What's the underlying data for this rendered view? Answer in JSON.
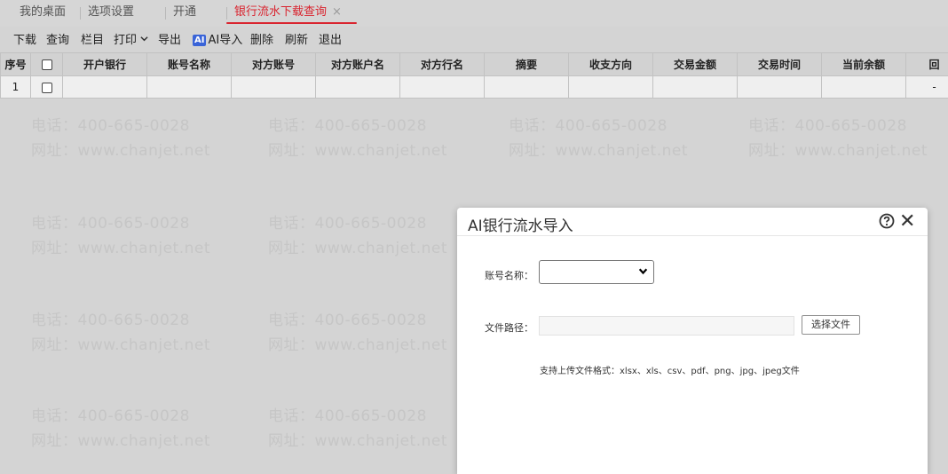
{
  "tabs": [
    {
      "label": "我的桌面",
      "active": false
    },
    {
      "label": "选项设置",
      "active": false
    },
    {
      "label": "开通",
      "active": false
    },
    {
      "label": "银行流水下载查询",
      "active": true,
      "close": "×"
    }
  ],
  "toolbar": {
    "download": "下载",
    "query": "查询",
    "columns": "栏目",
    "print": "打印",
    "print_caret": "⌄",
    "export": "导出",
    "ai_badge": "AI",
    "ai_import": "AI导入",
    "delete": "删除",
    "refresh": "刷新",
    "exit": "退出"
  },
  "table": {
    "headers": [
      "序号",
      "",
      "开户银行",
      "账号名称",
      "对方账号",
      "对方账户名",
      "对方行名",
      "摘要",
      "收支方向",
      "交易金额",
      "交易时间",
      "当前余额",
      "回"
    ],
    "rows": [
      {
        "index": "1",
        "last": "-"
      }
    ]
  },
  "watermark": {
    "phone": "电话：400-665-0028",
    "site": "网址：www.chanjet.net"
  },
  "dialog": {
    "title": "AI银行流水导入",
    "account_label": "账号名称：",
    "account_value": "",
    "file_label": "文件路径：",
    "file_value": "",
    "choose_file": "选择文件",
    "hint": "支持上传文件格式：xlsx、xls、csv、pdf、png、jpg、jpeg文件"
  },
  "colors": {
    "accent": "#d9242f",
    "ai_badge": "#3a64d8",
    "backdrop": "#d4d4d4"
  }
}
